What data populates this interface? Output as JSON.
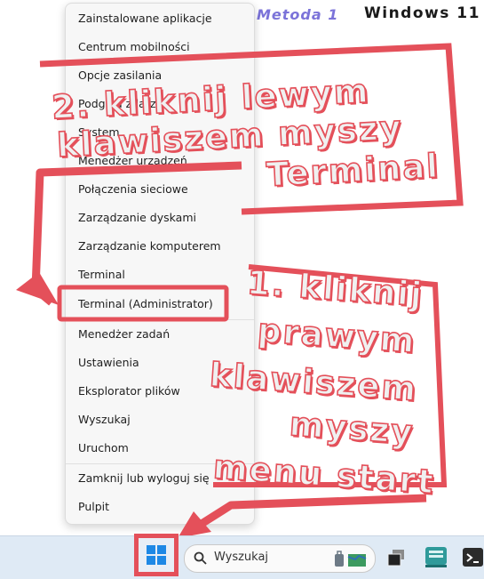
{
  "header": {
    "method": "Metoda 1",
    "os": "Windows 11"
  },
  "menu": {
    "items": [
      "Zainstalowane aplikacje",
      "Centrum mobilności",
      "Opcje zasilania",
      "Podgląd zdarzeń",
      "System",
      "Menedżer urządzeń",
      "Połączenia sieciowe",
      "Zarządzanie dyskami",
      "Zarządzanie komputerem",
      "Terminal",
      "Terminal (Administrator)",
      "Menedżer zadań",
      "Ustawienia",
      "Eksplorator plików",
      "Wyszukaj",
      "Uruchom",
      "Zamknij lub wyloguj się",
      "Pulpit"
    ]
  },
  "callouts": {
    "step2": [
      "2. kliknij lewym",
      "klawiszem myszy",
      "Terminal"
    ],
    "step1": [
      "1. kliknij",
      "prawym",
      "klawiszem",
      "myszy",
      "menu start"
    ]
  },
  "taskbar": {
    "search_text": "Wyszukaj"
  },
  "colors": {
    "callout": "#e4505a",
    "taskbar": "#dfeaf5",
    "menu_bg": "#f7f7f7"
  }
}
